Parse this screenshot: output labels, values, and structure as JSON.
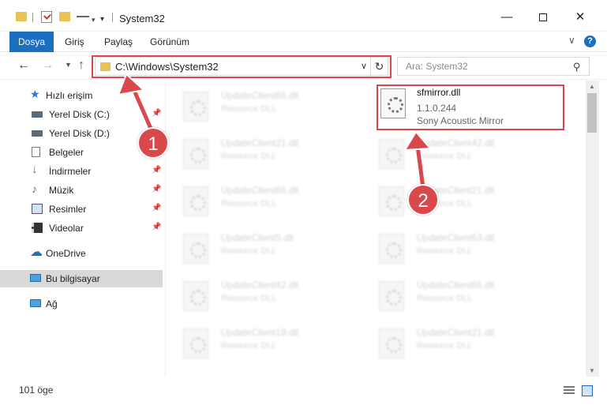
{
  "window": {
    "title": "System32",
    "minimize_glyph": "—",
    "maximize_glyph": "",
    "close_glyph": "✕"
  },
  "ribbon": {
    "tabs": [
      "Dosya",
      "Giriş",
      "Paylaş",
      "Görünüm"
    ],
    "chevron_glyph": "∨",
    "help_glyph": "?"
  },
  "address_bar": {
    "path": "C:\\Windows\\System32",
    "search_placeholder": "Ara: System32"
  },
  "glyphs": {
    "back": "←",
    "forward": "→",
    "history": "▼",
    "up": "↑",
    "address_chevron": "∨",
    "refresh": "↻",
    "search": "⚲",
    "pin": "📌"
  },
  "sidebar": {
    "quick_access": "Hızlı erişim",
    "items": [
      {
        "label": "Yerel Disk (C:)",
        "icon": "drive-icon",
        "pinned": true
      },
      {
        "label": "Yerel Disk (D:)",
        "icon": "drive-icon",
        "pinned": false
      },
      {
        "label": "Belgeler",
        "icon": "documents-icon",
        "pinned": false
      },
      {
        "label": "İndirmeler",
        "icon": "downloads-icon",
        "pinned": true
      },
      {
        "label": "Müzik",
        "icon": "music-icon",
        "pinned": true
      },
      {
        "label": "Resimler",
        "icon": "pictures-icon",
        "pinned": true
      },
      {
        "label": "Videolar",
        "icon": "videos-icon",
        "pinned": true
      }
    ],
    "onedrive": "OneDrive",
    "this_pc": "Bu bilgisayar",
    "network": "Ağ"
  },
  "files": {
    "focused": {
      "name": "sfmirror.dll",
      "version": "1.1.0.244",
      "description": "Sony Acoustic Mirror"
    },
    "left_column": [
      {
        "name": "UpdateClient65.dll",
        "type": "Resource DLL"
      },
      {
        "name": "UpdateClient21.dll",
        "type": "Resource DLL"
      },
      {
        "name": "UpdateClient65.dll",
        "type": "Resource DLL"
      },
      {
        "name": "UpdateClient5.dll",
        "type": "Resource DLL"
      },
      {
        "name": "UpdateClient42.dll",
        "type": "Resource DLL"
      },
      {
        "name": "UpdateClient19.dll",
        "type": "Resource DLL"
      }
    ],
    "right_column": [
      {
        "name": "UpdateClient42.dll",
        "type": "Resource DLL"
      },
      {
        "name": "UpdateClient21.dll",
        "type": "Resource DLL"
      },
      {
        "name": "UpdateClient63.dll",
        "type": "Resource DLL"
      },
      {
        "name": "UpdateClient65.dll",
        "type": "Resource DLL"
      },
      {
        "name": "UpdateClient21.dll",
        "type": "Resource DLL"
      }
    ]
  },
  "status_bar": {
    "item_count": "101 öge"
  },
  "annotations": {
    "callout_1": "1",
    "callout_2": "2",
    "highlight_color": "#d9484a"
  },
  "colors": {
    "accent": "#1a6fc1",
    "folder": "#e8c552",
    "selection": "#d9d9d9"
  }
}
